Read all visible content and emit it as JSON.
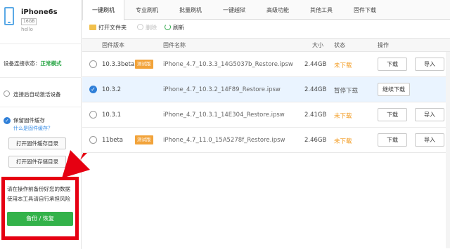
{
  "device": {
    "name": "iPhone6s",
    "capacity": "16GB",
    "user": "hello"
  },
  "sidebar": {
    "connection_label": "设备连接状态：",
    "connection_value": "正常模式",
    "auto_activate_label": "连接后自动激活设备",
    "keep_cache_label": "保留固件缓存",
    "keep_cache_link": "什么是固件缓存？",
    "open_cache_dir_button": "打开固件缓存目录",
    "open_storage_dir_button": "打开固件存储目录",
    "warning_line1": "请在操作前备份好您的数据",
    "warning_line2": "使用本工具请自行承担风险",
    "backup_button": "备份 / 恢复"
  },
  "tabs": [
    "一键刷机",
    "专业刷机",
    "批量刷机",
    "一键越狱",
    "高级功能",
    "其他工具",
    "固件下载"
  ],
  "toolbar": {
    "open_folder": "打开文件夹",
    "delete": "删除",
    "refresh": "刷新"
  },
  "table": {
    "headers": {
      "version": "固件版本",
      "name": "固件名称",
      "size": "大小",
      "status": "状态",
      "action": "操作"
    },
    "rows": [
      {
        "version": "10.3.3beta2",
        "badge": "测试版",
        "name": "iPhone_4.7_10.3.3_14G5037b_Restore.ipsw",
        "size": "2.44GB",
        "status": "未下载",
        "download": "下载",
        "import": "导入"
      },
      {
        "version": "10.3.2",
        "badge": "",
        "name": "iPhone_4.7_10.3.2_14F89_Restore.ipsw",
        "size": "2.44GB",
        "status": "暂停下载",
        "download": "继续下载",
        "import": ""
      },
      {
        "version": "10.3.1",
        "badge": "",
        "name": "iPhone_4.7_10.3.1_14E304_Restore.ipsw",
        "size": "2.41GB",
        "status": "未下载",
        "download": "下载",
        "import": "导入"
      },
      {
        "version": "11beta",
        "badge": "测试版",
        "name": "iPhone_4.7_11.0_15A5278f_Restore.ipsw",
        "size": "2.46GB",
        "status": "未下载",
        "download": "下载",
        "import": "导入"
      }
    ]
  },
  "colors": {
    "accent_blue": "#2f7fd8",
    "status_orange": "#f29a1f",
    "success_green": "#33b24a",
    "warning_red": "#e60012",
    "badge_orange": "#f2a33a"
  }
}
